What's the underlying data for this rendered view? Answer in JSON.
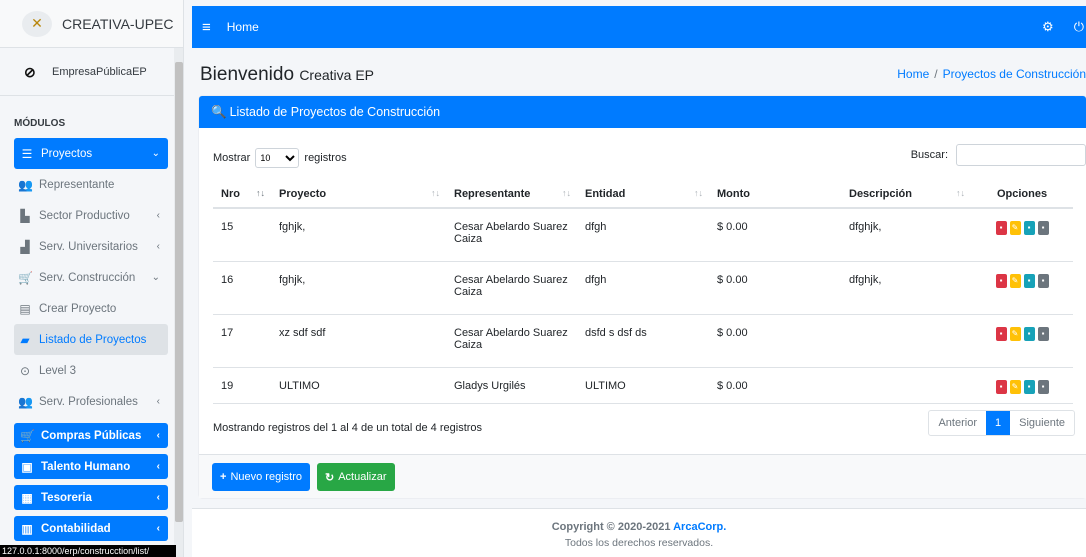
{
  "app": {
    "brand": "CREATIVA-UPEC",
    "user": "EmpresaPúblicaEP"
  },
  "sidebar": {
    "modules_label": "MÓDULOS",
    "items": [
      {
        "label": "Proyectos",
        "icon": "list-icon",
        "arrow": "⌄"
      },
      {
        "label": "Representante",
        "icon": "users-icon"
      },
      {
        "label": "Sector Productivo",
        "icon": "industry-icon",
        "arrow": "‹"
      },
      {
        "label": "Serv. Universitarios",
        "icon": "handshake-icon",
        "arrow": "‹"
      },
      {
        "label": "Serv. Construcción",
        "icon": "cart-icon",
        "arrow": "⌄"
      },
      {
        "label": "Crear Proyecto",
        "icon": "file-icon"
      },
      {
        "label": "Listado de Proyectos",
        "icon": "folder-open-icon"
      },
      {
        "label": "Level 3",
        "icon": "circle-dot-icon"
      },
      {
        "label": "Serv. Profesionales",
        "icon": "users-icon",
        "arrow": "‹"
      },
      {
        "label": "Compras Públicas",
        "icon": "cart-icon",
        "arrow": "‹"
      },
      {
        "label": "Talento Humano",
        "icon": "id-card-icon",
        "arrow": "‹"
      },
      {
        "label": "Tesoreria",
        "icon": "calendar-icon",
        "arrow": "‹"
      },
      {
        "label": "Contabilidad",
        "icon": "book-icon",
        "arrow": "‹"
      }
    ],
    "url_tooltip": "127.0.0.1:8000/erp/construcction/list/"
  },
  "topbar": {
    "home": "Home"
  },
  "header": {
    "title": "Bienvenido",
    "subtitle": "Creativa EP",
    "breadcrumb": [
      "Home",
      "Proyectos de Construcción"
    ]
  },
  "card": {
    "title": "Listado de Proyectos de Construcción",
    "show_prefix": "Mostrar",
    "show_value": "10",
    "show_suffix": "registros",
    "search_label": "Buscar:",
    "columns": [
      "Nro",
      "Proyecto",
      "Representante",
      "Entidad",
      "Monto",
      "Descripción",
      "Opciones"
    ],
    "rows": [
      {
        "nro": "15",
        "proyecto": "fghjk,",
        "representante": "Cesar Abelardo Suarez Caiza",
        "entidad": "dfgh",
        "monto": "$ 0.00",
        "descripcion": "dfghjk,"
      },
      {
        "nro": "16",
        "proyecto": "fghjk,",
        "representante": "Cesar Abelardo Suarez Caiza",
        "entidad": "dfgh",
        "monto": "$ 0.00",
        "descripcion": "dfghjk,"
      },
      {
        "nro": "17",
        "proyecto": "xz sdf sdf",
        "representante": "Cesar Abelardo Suarez Caiza",
        "entidad": "dsfd s dsf ds",
        "monto": "$ 0.00",
        "descripcion": ""
      },
      {
        "nro": "19",
        "proyecto": "ULTIMO",
        "representante": "Gladys Urgilés",
        "entidad": "ULTIMO",
        "monto": "$ 0.00",
        "descripcion": ""
      }
    ],
    "info": "Mostrando registros del 1 al 4 de un total de 4 registros",
    "pagination": {
      "prev": "Anterior",
      "current": "1",
      "next": "Siguiente"
    },
    "buttons": {
      "new": "Nuevo registro",
      "refresh": "Actualizar"
    }
  },
  "footer": {
    "copyright_prefix": "Copyright © 2020-2021",
    "company": "ArcaCorp.",
    "rights": "Todos los derechos reservados."
  },
  "colors": {
    "primary": "#007bff",
    "success": "#28a745",
    "danger": "#dc3545",
    "warning": "#ffc107",
    "info": "#17a2b8"
  }
}
